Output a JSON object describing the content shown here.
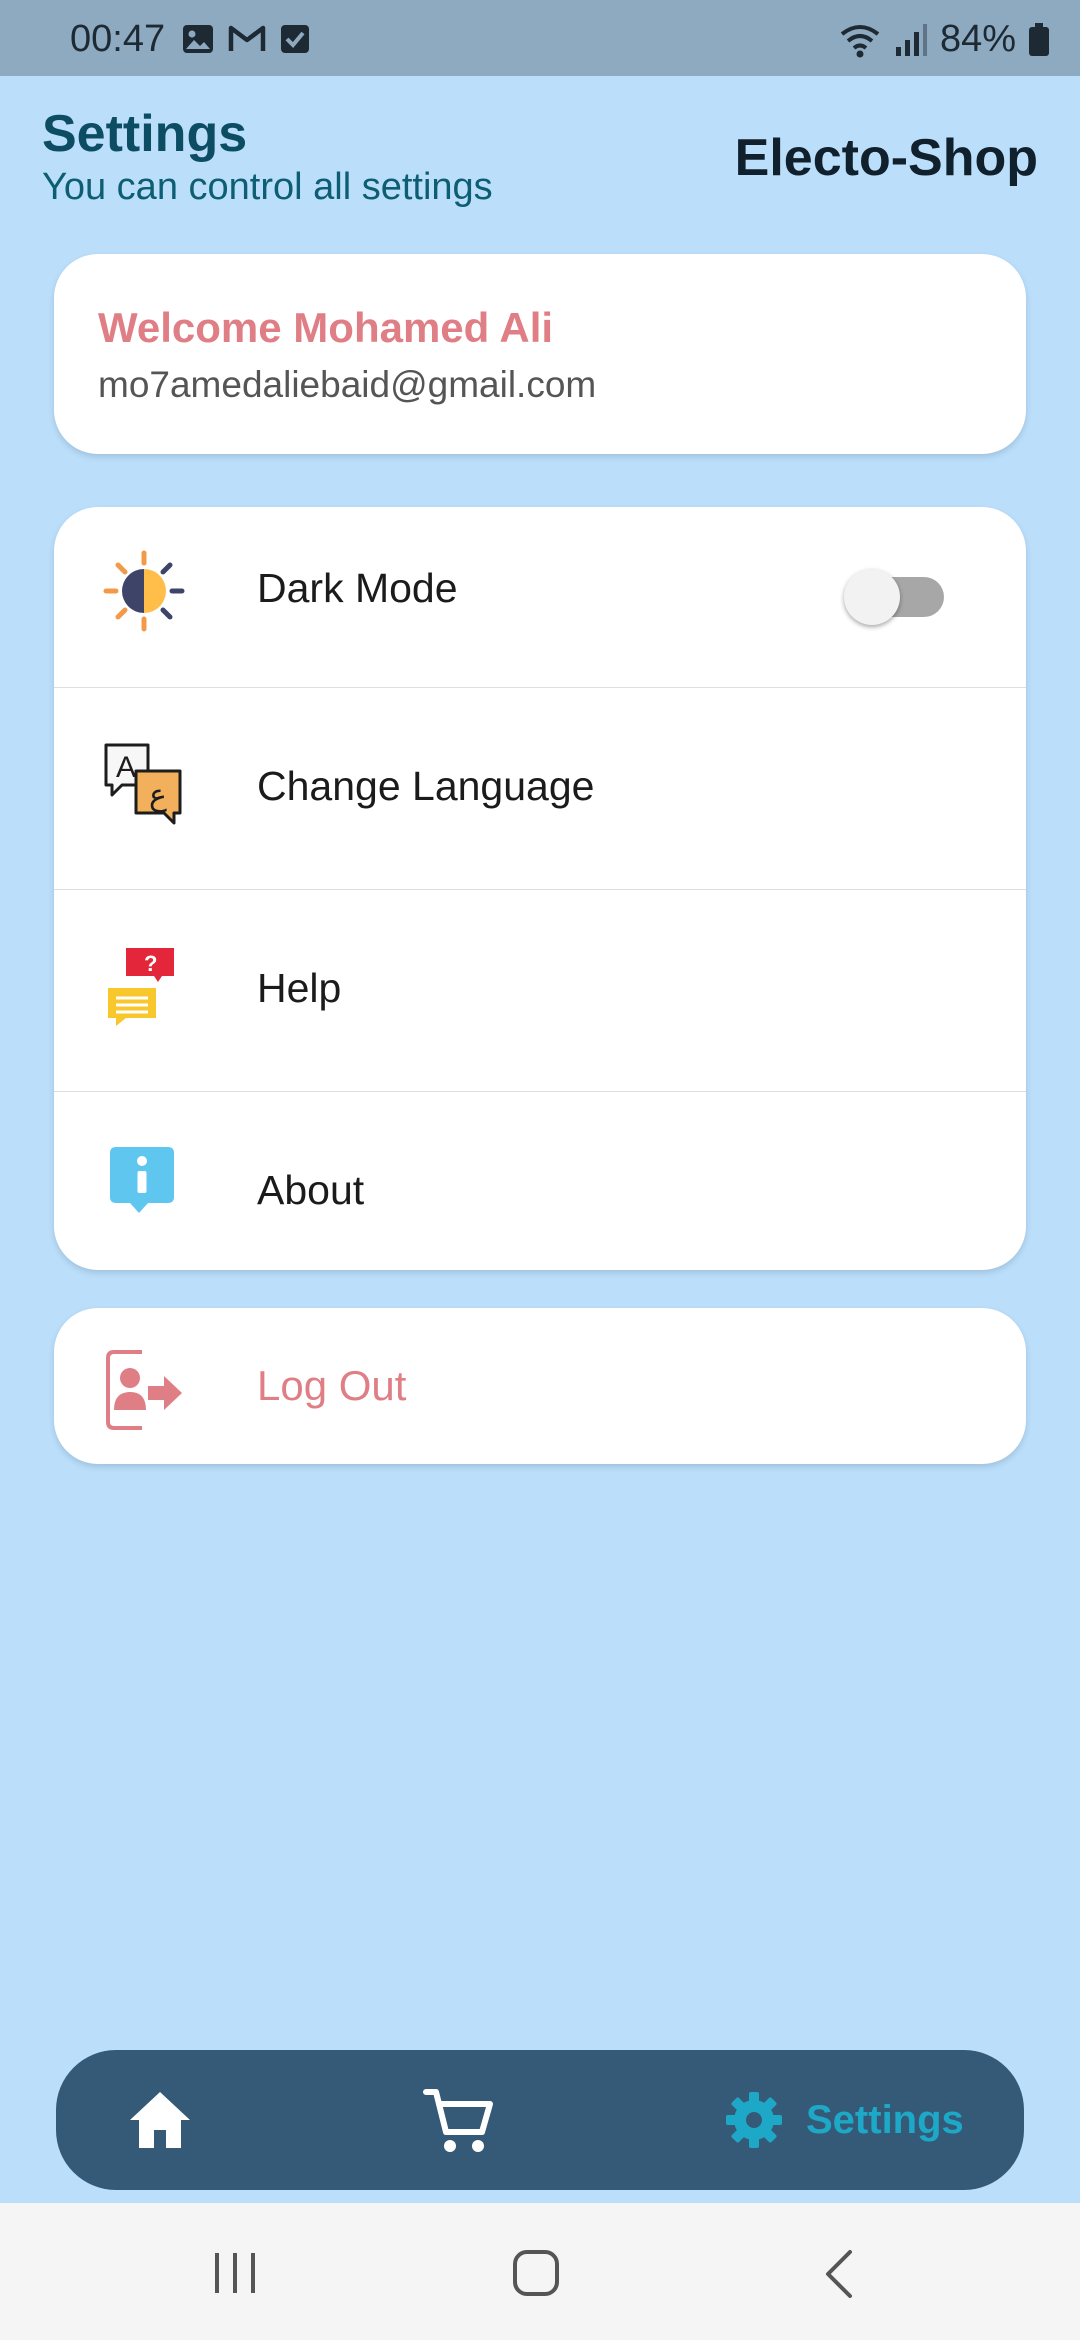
{
  "status_bar": {
    "time": "00:47",
    "battery": "84%",
    "left_icons": [
      "gallery-icon",
      "gmail-icon",
      "checkbox-icon"
    ],
    "right_icons": [
      "wifi-icon",
      "signal-icon",
      "battery-icon"
    ]
  },
  "header": {
    "title": "Settings",
    "subtitle": "You can control all settings",
    "brand": "Electo-Shop"
  },
  "user": {
    "welcome": "Welcome Mohamed Ali",
    "email": "mo7amedaliebaid@gmail.com"
  },
  "menu": {
    "items": [
      {
        "label": "Dark Mode",
        "icon": "brightness-icon"
      },
      {
        "label": "Change Language",
        "icon": "translate-icon"
      },
      {
        "label": "Help",
        "icon": "help-chat-icon"
      },
      {
        "label": "About",
        "icon": "info-icon"
      }
    ],
    "dark_mode_on": false
  },
  "logout": {
    "label": "Log Out",
    "icon": "logout-icon"
  },
  "bottom_nav": {
    "items": [
      {
        "icon": "home-icon",
        "active": false
      },
      {
        "icon": "cart-icon",
        "active": false
      },
      {
        "icon": "settings-icon",
        "label": "Settings",
        "active": true
      }
    ]
  },
  "colors": {
    "background": "#bbdefa",
    "accent_pink": "#e07e86",
    "nav_bar": "#355a78",
    "nav_active": "#1ea8c7",
    "header_title": "#0d4d63"
  }
}
